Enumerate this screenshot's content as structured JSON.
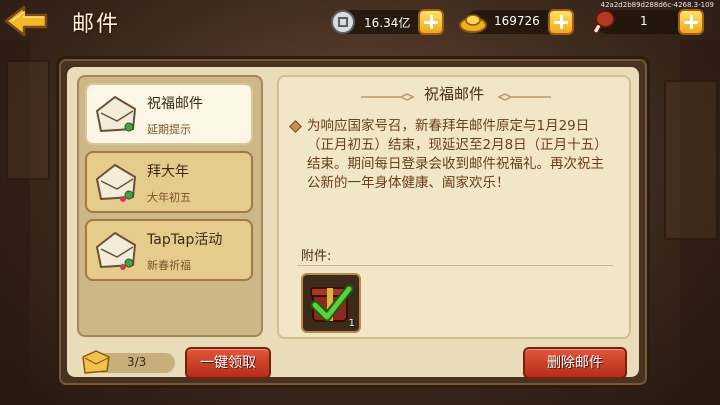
{
  "header": {
    "title": "邮件",
    "device_id": "42a2d2b89d288d6c-4268.3-109"
  },
  "resources": {
    "silver": "16.34亿",
    "gold": "169726",
    "stamina": "1"
  },
  "mails": [
    {
      "title": "祝福邮件",
      "subtitle": "延期提示",
      "selected": true
    },
    {
      "title": "拜大年",
      "subtitle": "大年初五",
      "selected": false
    },
    {
      "title": "TapTap活动",
      "subtitle": "新春祈福",
      "selected": false
    }
  ],
  "mail_count": "3/3",
  "buttons": {
    "claim_all": "一键领取",
    "delete": "删除邮件"
  },
  "detail": {
    "title": "祝福邮件",
    "body": "为响应国家号召，新春拜年邮件原定与1月29日（正月初五）结束，现延迟至2月8日（正月十五）结束。期间每日登录会收到邮件祝福礼。再次祝主公新的一年身体健康、阖家欢乐！",
    "attachment_label": "附件:",
    "attachment_qty": "1"
  }
}
